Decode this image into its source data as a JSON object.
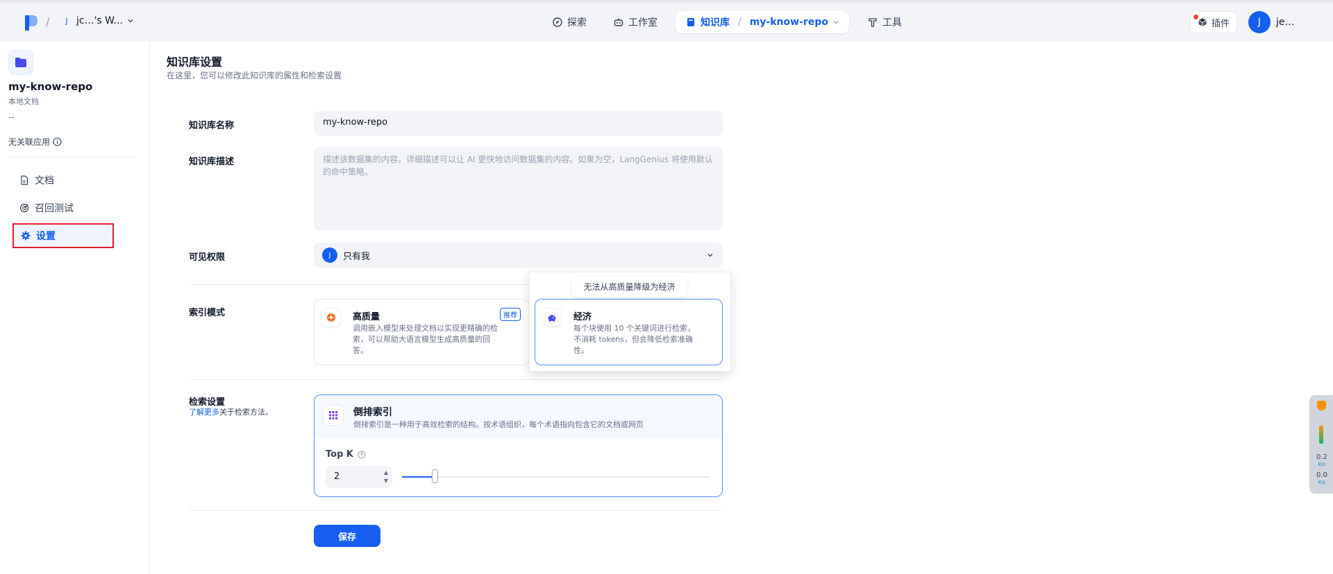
{
  "header": {
    "workspace_initial": "J",
    "workspace_name": "jc…'s W...",
    "nav": {
      "explore": "探索",
      "studio": "工作室",
      "knowledge": "知识库",
      "repo": "my-know-repo",
      "tools": "工具"
    },
    "plugin_label": "插件",
    "user_initial": "J",
    "user_name": "je…"
  },
  "sidebar": {
    "repo_name": "my-know-repo",
    "repo_type": "本地文档",
    "repo_dash": "--",
    "no_apps": "无关联应用",
    "items": [
      {
        "label": "文档",
        "icon": "document-icon"
      },
      {
        "label": "召回测试",
        "icon": "target-icon"
      },
      {
        "label": "设置",
        "icon": "gear-icon"
      }
    ]
  },
  "main": {
    "title": "知识库设置",
    "desc": "在这里，您可以修改此知识库的属性和检索设置",
    "name_label": "知识库名称",
    "name_value": "my-know-repo",
    "desc_label": "知识库描述",
    "desc_placeholder": "描述该数据集的内容。详细描述可以让 AI 更快地访问数据集的内容。如果为空，LangGenius 将使用默认的命中策略。",
    "perm_label": "可见权限",
    "perm_initial": "J",
    "perm_value": "只有我",
    "index_label": "索引模式",
    "hq_title": "高质量",
    "hq_badge": "推荐",
    "hq_desc_1": "调用嵌入模型来处理文档以实现更精确的检",
    "hq_desc_2": "索，可以帮助大语言模型生成高质量的回",
    "hq_desc_3": "答。",
    "eco_title": "经济",
    "eco_desc_1": "每个块使用 10 个关键词进行检索，",
    "eco_desc_2": "不消耗 tokens，但会降低检索准确",
    "eco_desc_3": "性。",
    "tooltip": "无法从高质量降级为经济",
    "retrieval_label": "检索设置",
    "learn_more": "了解更多",
    "learn_more_suffix": "关于检索方法。",
    "inverted_title": "倒排索引",
    "inverted_desc": "倒排索引是一种用于高效检索的结构。按术语组织，每个术语指向包含它的文档或网页",
    "topk_label": "Top K",
    "topk_value": "2",
    "topk_slider": {
      "value": 2,
      "min": 1,
      "max": 10
    },
    "save": "保存"
  },
  "netwidget": {
    "up": "0.2",
    "up_unit": "K/s",
    "down": "0.0",
    "down_unit": "K/s"
  },
  "colors": {
    "primary": "#155eef",
    "highlight_border": "#e11d2a",
    "selected_border": "#528bff"
  }
}
